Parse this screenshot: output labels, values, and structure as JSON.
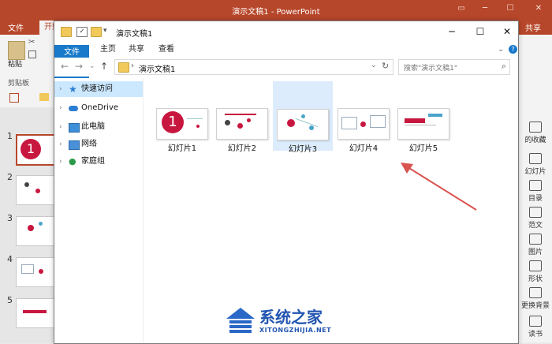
{
  "powerpoint": {
    "title": "演示文稿1 - PowerPoint",
    "tabs": [
      "文件",
      "开始"
    ],
    "share_label": "共享",
    "ribbon_labels": {
      "paste": "粘贴",
      "clipboard": "剪贴板"
    },
    "thumbnails": [
      "1",
      "2",
      "3",
      "4",
      "5"
    ],
    "first_thumb_number": "1",
    "right_panel": [
      "的收藏",
      "幻灯片",
      "目录",
      "范文",
      "图片",
      "形状",
      "更换背景",
      "读书"
    ]
  },
  "explorer": {
    "title": "演示文稿1",
    "ribbon_tabs": {
      "file": "文件",
      "home": "主页",
      "share": "共享",
      "view": "查看"
    },
    "address": {
      "path": "演示文稿1",
      "separator": "›"
    },
    "search": {
      "placeholder": "搜索\"演示文稿1\""
    },
    "nav": [
      {
        "label": "快速访问",
        "icon": "star-icon",
        "selected": true
      },
      {
        "label": "OneDrive",
        "icon": "cloud-icon",
        "selected": false
      },
      {
        "label": "此电脑",
        "icon": "computer-icon",
        "selected": false
      },
      {
        "label": "网络",
        "icon": "network-icon",
        "selected": false
      },
      {
        "label": "家庭组",
        "icon": "homegroup-icon",
        "selected": false
      }
    ],
    "files": [
      {
        "name": "幻灯片1",
        "selected": false
      },
      {
        "name": "幻灯片2",
        "selected": false
      },
      {
        "name": "幻灯片3",
        "selected": true
      },
      {
        "name": "幻灯片4",
        "selected": false
      },
      {
        "name": "幻灯片5",
        "selected": false
      }
    ],
    "slide1_number": "1"
  },
  "watermark": {
    "title": "系统之家",
    "subtitle": "XITONGZHIJIA.NET"
  },
  "colors": {
    "ppt_accent": "#b7472a",
    "explorer_blue": "#1979ca",
    "arrow": "#d9534f",
    "watermark": "#2255b0"
  }
}
